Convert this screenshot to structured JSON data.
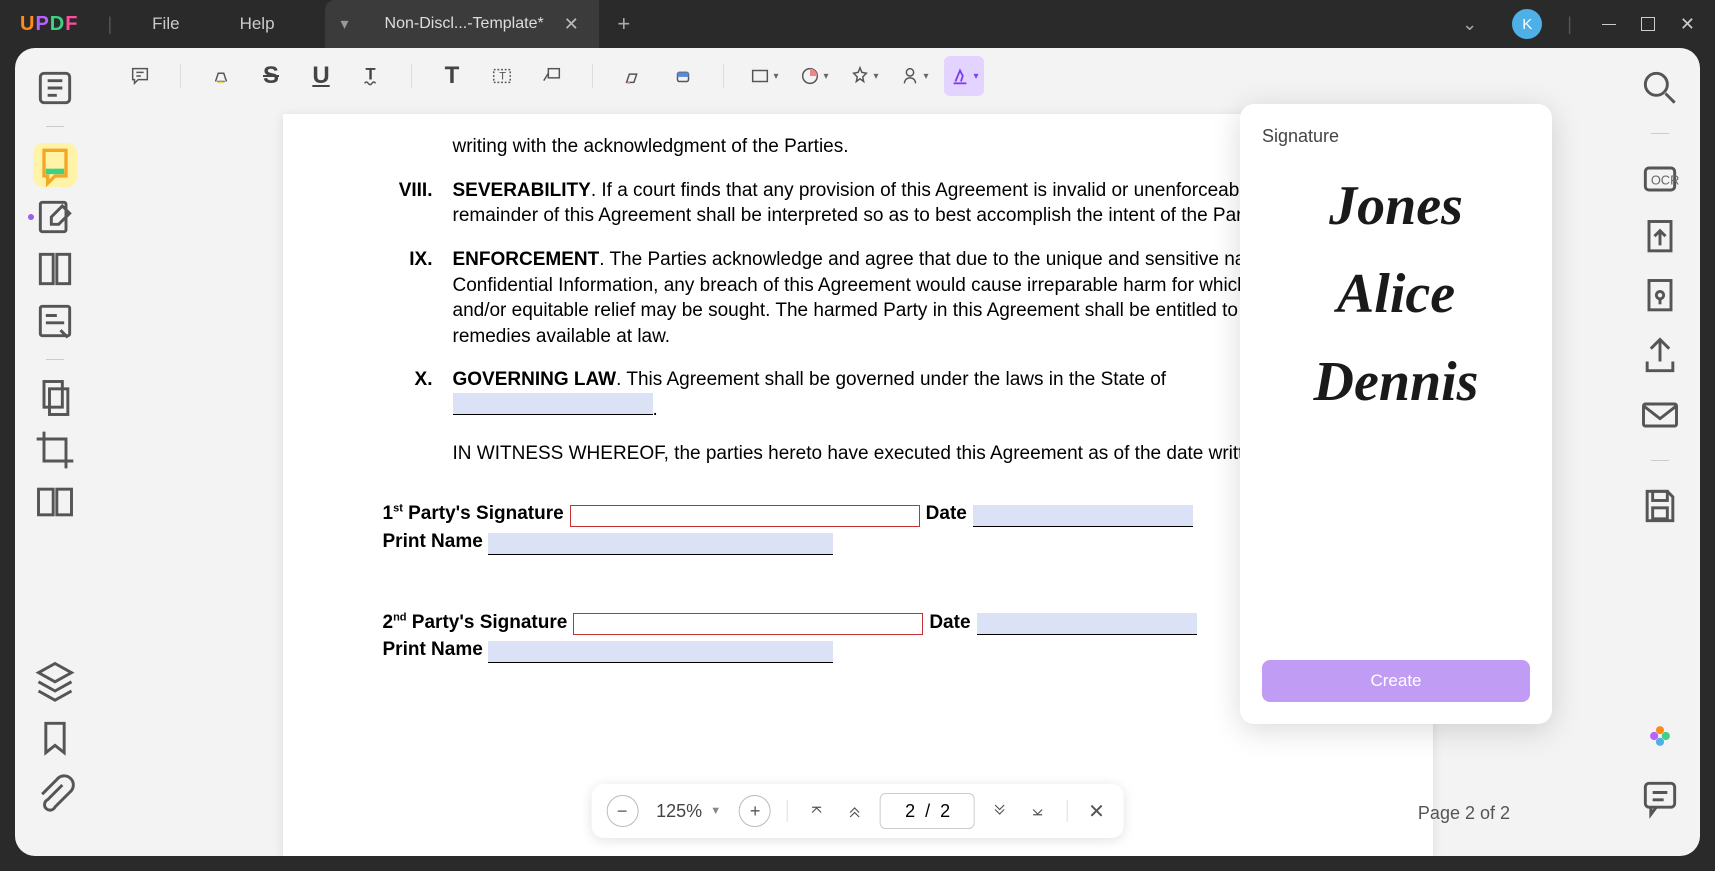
{
  "app": {
    "name": "UPDF",
    "file_menu": "File",
    "help_menu": "Help"
  },
  "tab": {
    "title": "Non-Discl...-Template*"
  },
  "user": {
    "initial": "K"
  },
  "doc": {
    "intro_tail": "writing with the acknowledgment of the Parties.",
    "s8": {
      "num": "VIII.",
      "title": "SEVERABILITY",
      "body": ". If a court finds that any provision of this Agreement is invalid or unenforceable, the remainder of this Agreement shall be interpreted so as to best accomplish the intent of the Parties."
    },
    "s9": {
      "num": "IX.",
      "title": "ENFORCEMENT",
      "body": ". The Parties acknowledge and agree that due to the unique and sensitive nature of the Confidential Information, any breach of this Agreement would cause irreparable harm for which damages and/or equitable relief may be sought. The harmed Party in this Agreement shall be entitled to all remedies available at law."
    },
    "s10": {
      "num": "X.",
      "title": "GOVERNING LAW",
      "body_pre": ". This Agreement shall be governed under the laws in the State of",
      "body_post": "."
    },
    "witness": "IN WITNESS WHEREOF, the parties hereto have executed this Agreement as of the date written below.",
    "party1": {
      "sig_label_pre": "1",
      "sig_label_sup": "st",
      "sig_label_post": " Party's Signature",
      "date_label": "Date",
      "print_label": "Print Name"
    },
    "party2": {
      "sig_label_pre": "2",
      "sig_label_sup": "nd",
      "sig_label_post": " Party's Signature",
      "date_label": "Date",
      "print_label": "Print Name"
    }
  },
  "signature_panel": {
    "title": "Signature",
    "items": [
      "Jones",
      "Alice",
      "Dennis"
    ],
    "create_label": "Create"
  },
  "nav": {
    "zoom": "125%",
    "page_input": "2  /  2",
    "page_label": "Page 2 of 2"
  }
}
